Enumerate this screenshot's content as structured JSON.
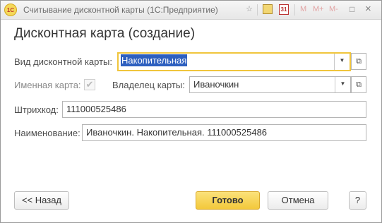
{
  "titlebar": {
    "title": "Считывание дисконтной карты  (1С:Предприятие)",
    "logo_text": "1С",
    "icons": [
      "star-icon",
      "calculator-icon",
      "calendar-icon",
      "m-icon",
      "m-plus-icon",
      "m-minus-icon",
      "maximize-icon",
      "close-icon"
    ],
    "calendar_label": "31",
    "m_label": "M",
    "m_plus_label": "M+",
    "m_minus_label": "M-",
    "maximize_label": "□",
    "close_label": "×"
  },
  "heading": "Дисконтная карта (создание)",
  "form": {
    "card_type_label": "Вид дисконтной карты:",
    "card_type_value": "Накопительная",
    "named_card_label": "Именная карта:",
    "named_card_checked": true,
    "owner_label": "Владелец карты:",
    "owner_value": "Иваночкин",
    "barcode_label": "Штрихкод:",
    "barcode_value": "111000525486",
    "name_label": "Наименование:",
    "name_value": "Иваночкин. Накопительная. 111000525486"
  },
  "buttons": {
    "back": "<< Назад",
    "done": "Готово",
    "cancel": "Отмена",
    "help": "?"
  },
  "colors": {
    "focus_border": "#f0c53c",
    "primary_button": "#f3c83b",
    "selection": "#2d5fbf"
  }
}
